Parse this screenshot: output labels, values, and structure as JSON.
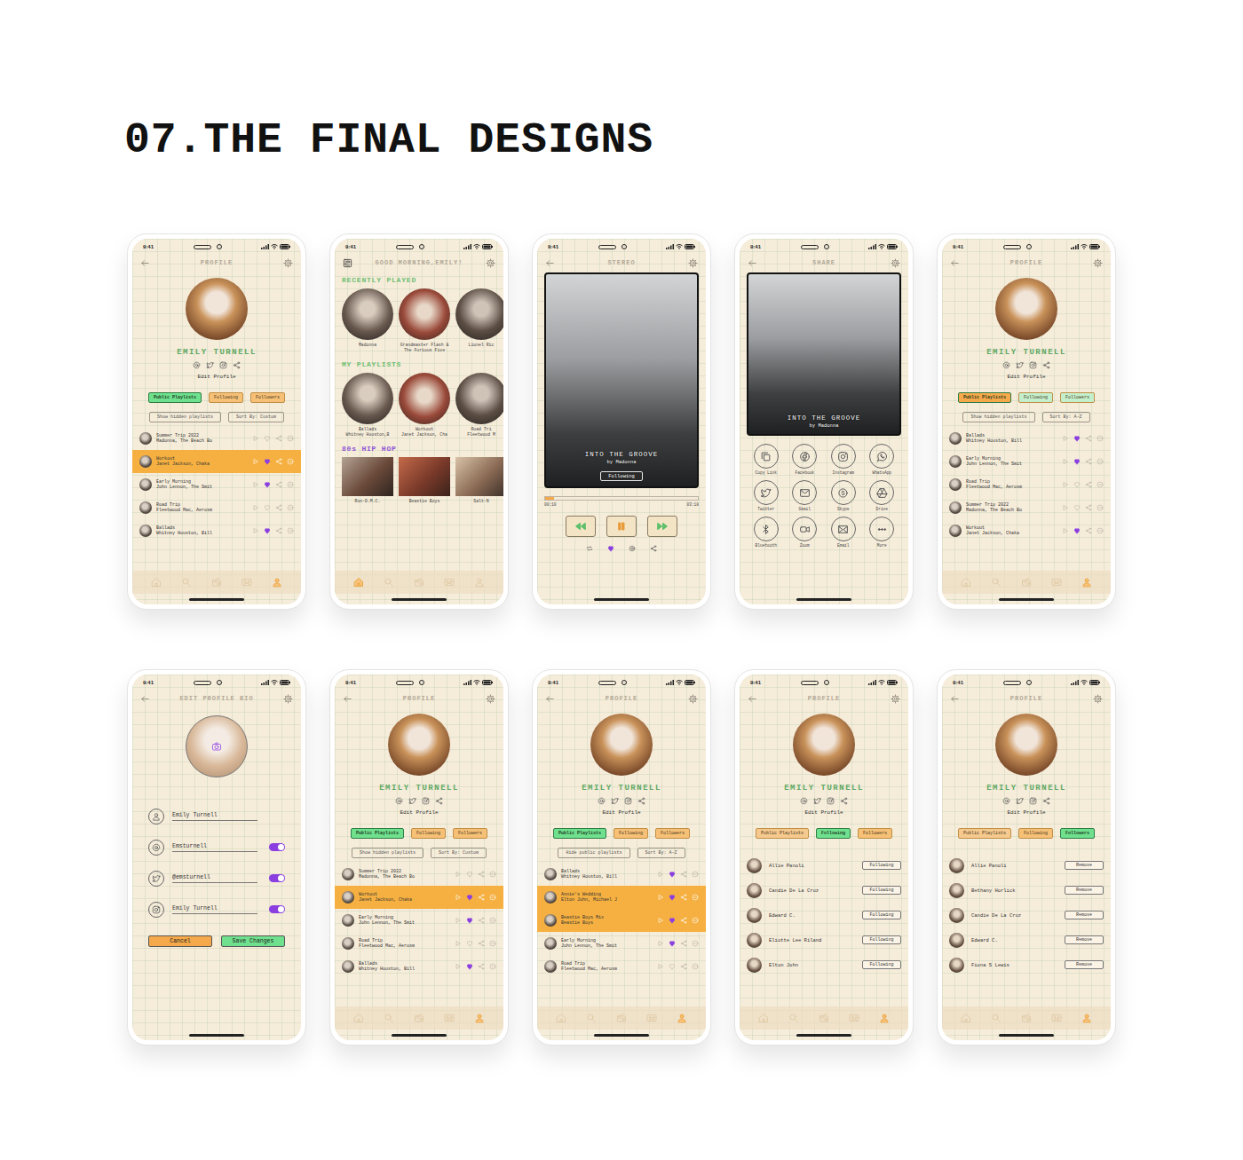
{
  "page": {
    "title": "07.THE FINAL DESIGNS"
  },
  "screens": [
    {
      "kind": "profile",
      "time": "9:41",
      "title": "PROFILE",
      "profile": {
        "name": "EMILY TURNELL",
        "edit": "Edit Profile"
      },
      "tabs": [
        {
          "label": "Public Playlists",
          "selected": true,
          "color": "#6fe08d"
        },
        {
          "label": "Following",
          "selected": false,
          "color": "#f6c077"
        },
        {
          "label": "Followers",
          "selected": false,
          "color": "#f6c077"
        }
      ],
      "filters": [
        "Show hidden playlists",
        "Sort By: Custom"
      ],
      "list": {
        "kind": "playlists",
        "rows": [
          {
            "title": "Summer Trip 2022",
            "artists": "Madonna, The Beach Bo",
            "liked": false,
            "highlighted": false
          },
          {
            "title": "Workout",
            "artists": "Janet Jackson, Chaka",
            "liked": true,
            "highlighted": true
          },
          {
            "title": "Early Morning",
            "artists": "John Lennon, The Smit",
            "liked": true,
            "highlighted": false
          },
          {
            "title": "Road Trip",
            "artists": "Fleetwood Mac, Aerosm",
            "liked": false,
            "highlighted": false
          },
          {
            "title": "Ballads",
            "artists": "Whitney Houston, Bill",
            "liked": true,
            "highlighted": false
          }
        ]
      },
      "nav": [
        {
          "selected": false
        },
        {
          "selected": false
        },
        {
          "selected": false
        },
        {
          "selected": false
        },
        {
          "selected": true
        }
      ]
    },
    {
      "kind": "home",
      "time": "9:41",
      "title": "GOOD MORNING,EMILY!",
      "sections": [
        {
          "title": "RECENTLY PLAYED",
          "kind": "circle",
          "color": "#6fbf73",
          "items": [
            {
              "label": "Madonna",
              "sub": ""
            },
            {
              "label": "Grandmaster Flash & The Furious Five",
              "sub": ""
            },
            {
              "label": "Lionel Ric",
              "sub": ""
            }
          ]
        },
        {
          "title": "MY PLAYLISTS",
          "kind": "circle",
          "color": "#6fbf73",
          "items": [
            {
              "label": "Ballads",
              "sub": "Whitney Houston,B"
            },
            {
              "label": "Workout",
              "sub": "Janet Jackson, Cha"
            },
            {
              "label": "Road Tri",
              "sub": "Fleetwood M"
            }
          ]
        },
        {
          "title": "80s HIP HOP",
          "kind": "square",
          "color": "#8b4fd6",
          "items": [
            {
              "label": "Run-D.M.C.",
              "sub": ""
            },
            {
              "label": "Beastie Boys",
              "sub": ""
            },
            {
              "label": "Salt-N",
              "sub": ""
            }
          ]
        }
      ],
      "nav": [
        {
          "selected": true
        },
        {
          "selected": false
        },
        {
          "selected": false
        },
        {
          "selected": false
        },
        {
          "selected": false
        }
      ]
    },
    {
      "kind": "player",
      "time": "9:41",
      "title": "STEREO",
      "track": {
        "title": "INTO THE GROOVE",
        "artist": "by Madonna",
        "follow": "Following"
      },
      "progress": {
        "elapsed": "00:10",
        "total": "03:18",
        "level": 0.06
      },
      "liked": true
    },
    {
      "kind": "share",
      "time": "9:41",
      "title": "SHARE",
      "track": {
        "title": "INTO THE GROOVE",
        "artist": "by Madonna"
      },
      "options": [
        "Copy Link",
        "Facebook",
        "Instagram",
        "WhatsApp",
        "Twitter",
        "Gmail",
        "Skype",
        "Drive",
        "Bluetooth",
        "Zoom",
        "Email",
        "More"
      ]
    },
    {
      "kind": "profile",
      "time": "9:41",
      "title": "PROFILE",
      "profile": {
        "name": "EMILY TURNELL",
        "edit": "Edit Profile"
      },
      "tabs": [
        {
          "label": "Public Playlists",
          "selected": true,
          "color": "#f5a94a"
        },
        {
          "label": "Following",
          "selected": false,
          "color": "#c4efcc"
        },
        {
          "label": "Followers",
          "selected": false,
          "color": "#c4efcc"
        }
      ],
      "filters": [
        "Show hidden playlists",
        "Sort By: A-Z"
      ],
      "list": {
        "kind": "playlists",
        "rows": [
          {
            "title": "Ballads",
            "artists": "Whitney Houston, Bill",
            "liked": true,
            "highlighted": false
          },
          {
            "title": "Early Morning",
            "artists": "John Lennon, The Smit",
            "liked": true,
            "highlighted": false
          },
          {
            "title": "Road Trip",
            "artists": "Fleetwood Mac, Aerosm",
            "liked": false,
            "highlighted": false
          },
          {
            "title": "Summer Trip 2022",
            "artists": "Madonna, The Beach Bo",
            "liked": false,
            "highlighted": false
          },
          {
            "title": "Workout",
            "artists": "Janet Jackson, Chaka",
            "liked": true,
            "highlighted": false
          }
        ]
      },
      "nav": [
        {
          "selected": false
        },
        {
          "selected": false
        },
        {
          "selected": false
        },
        {
          "selected": false
        },
        {
          "selected": true
        }
      ]
    },
    {
      "kind": "edit",
      "time": "9:41",
      "title": "EDIT PROFILE BIO",
      "fields": [
        {
          "value": "Emily Turnell",
          "kind": "plain",
          "on": false
        },
        {
          "value": "Emsturnell",
          "kind": "toggle",
          "on": true
        },
        {
          "value": "@emsturnell",
          "kind": "toggle",
          "on": true
        },
        {
          "value": "Emily Turnell",
          "kind": "toggle",
          "on": true
        }
      ],
      "buttons": [
        {
          "label": "Cancel",
          "color": "#f5a94a"
        },
        {
          "label": "Save Changes",
          "color": "#6fe08d"
        }
      ]
    },
    {
      "kind": "profile",
      "time": "9:41",
      "title": "PROFILE",
      "profile": {
        "name": "EMILY TURNELL",
        "edit": "Edit Profile"
      },
      "tabs": [
        {
          "label": "Public Playlists",
          "selected": true,
          "color": "#6fe08d"
        },
        {
          "label": "Following",
          "selected": false,
          "color": "#f6c077"
        },
        {
          "label": "Followers",
          "selected": false,
          "color": "#f6c077"
        }
      ],
      "filters": [
        "Show hidden playlists",
        "Sort By: Custom"
      ],
      "list": {
        "kind": "playlists",
        "rows": [
          {
            "title": "Summer Trip 2022",
            "artists": "Madonna, The Beach Bo",
            "liked": false,
            "highlighted": false
          },
          {
            "title": "Workout",
            "artists": "Janet Jackson, Chaka",
            "liked": true,
            "highlighted": true
          },
          {
            "title": "Early Morning",
            "artists": "John Lennon, The Smit",
            "liked": true,
            "highlighted": false
          },
          {
            "title": "Road Trip",
            "artists": "Fleetwood Mac, Aerosm",
            "liked": false,
            "highlighted": false
          },
          {
            "title": "Ballads",
            "artists": "Whitney Houston, Bill",
            "liked": true,
            "highlighted": false
          }
        ]
      },
      "nav": [
        {
          "selected": false
        },
        {
          "selected": false
        },
        {
          "selected": false
        },
        {
          "selected": false
        },
        {
          "selected": true
        }
      ]
    },
    {
      "kind": "profile",
      "time": "9:41",
      "title": "PROFILE",
      "profile": {
        "name": "EMILY TURNELL",
        "edit": "Edit Profile"
      },
      "tabs": [
        {
          "label": "Public Playlists",
          "selected": true,
          "color": "#6fe08d"
        },
        {
          "label": "Following",
          "selected": false,
          "color": "#f6c077"
        },
        {
          "label": "Followers",
          "selected": false,
          "color": "#f6c077"
        }
      ],
      "filters": [
        "Hide public playlists",
        "Sort By: A-Z"
      ],
      "list": {
        "kind": "playlists",
        "rows": [
          {
            "title": "Ballads",
            "artists": "Whitney Houston, Bill",
            "liked": true,
            "highlighted": false
          },
          {
            "title": "Annie's Wedding",
            "artists": "Elton John, Michael J",
            "liked": true,
            "highlighted": true
          },
          {
            "title": "Beastie Boys Mix",
            "artists": "Beastie Boys",
            "liked": true,
            "highlighted": true
          },
          {
            "title": "Early Morning",
            "artists": "John Lennon, The Smit",
            "liked": true,
            "highlighted": false
          },
          {
            "title": "Road Trip",
            "artists": "Fleetwood Mac, Aerosm",
            "liked": false,
            "highlighted": false
          }
        ]
      },
      "nav": [
        {
          "selected": false
        },
        {
          "selected": false
        },
        {
          "selected": false
        },
        {
          "selected": false
        },
        {
          "selected": true
        }
      ]
    },
    {
      "kind": "profile",
      "time": "9:41",
      "title": "PROFILE",
      "profile": {
        "name": "EMILY TURNELL",
        "edit": "Edit Profile"
      },
      "tabs": [
        {
          "label": "Public Playlists",
          "selected": false,
          "color": "#f6c98e"
        },
        {
          "label": "Following",
          "selected": true,
          "color": "#6fe08d"
        },
        {
          "label": "Followers",
          "selected": false,
          "color": "#f6c077"
        }
      ],
      "list": {
        "kind": "people",
        "rows": [
          {
            "name": "Allie Panoli",
            "action": "Following"
          },
          {
            "name": "Candie De La Cruz",
            "action": "Following"
          },
          {
            "name": "Edward C.",
            "action": "Following"
          },
          {
            "name": "Eliotte Lee Riland",
            "action": "Following"
          },
          {
            "name": "Elton John",
            "action": "Following"
          }
        ]
      },
      "nav": [
        {
          "selected": false
        },
        {
          "selected": false
        },
        {
          "selected": false
        },
        {
          "selected": false
        },
        {
          "selected": true
        }
      ]
    },
    {
      "kind": "profile",
      "time": "9:41",
      "title": "PROFILE",
      "profile": {
        "name": "EMILY TURNELL",
        "edit": "Edit Profile"
      },
      "tabs": [
        {
          "label": "Public Playlists",
          "selected": false,
          "color": "#f6c98e"
        },
        {
          "label": "Following",
          "selected": false,
          "color": "#f6c077"
        },
        {
          "label": "Followers",
          "selected": true,
          "color": "#6fe08d"
        }
      ],
      "list": {
        "kind": "people",
        "rows": [
          {
            "name": "Allie Panoli",
            "action": "Remove"
          },
          {
            "name": "Bethany Horlick",
            "action": "Remove"
          },
          {
            "name": "Candie De La Cruz",
            "action": "Remove"
          },
          {
            "name": "Edward C.",
            "action": "Remove"
          },
          {
            "name": "Fiona S Lewis",
            "action": "Remove"
          }
        ]
      },
      "nav": [
        {
          "selected": false
        },
        {
          "selected": false
        },
        {
          "selected": false
        },
        {
          "selected": false
        },
        {
          "selected": true
        }
      ]
    }
  ]
}
